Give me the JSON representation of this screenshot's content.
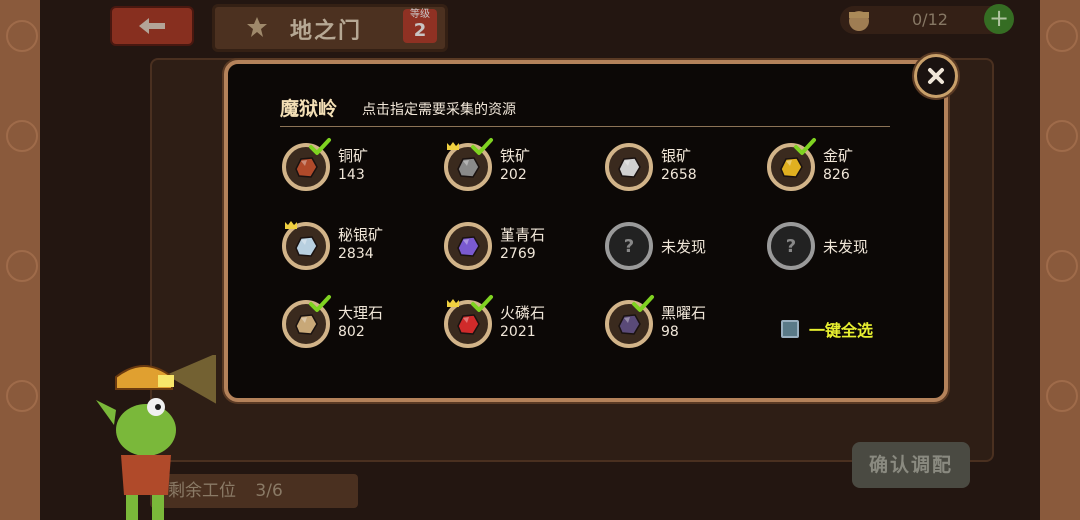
{
  "header": {
    "gate_title": "地之门",
    "level_label": "等级",
    "level_value": "2",
    "worker_count": "0/12"
  },
  "background": {
    "remaining_slots_label": "剩余工位",
    "remaining_slots_value": "3/6",
    "confirm_label": "确认调配"
  },
  "modal": {
    "title": "魔狱岭",
    "subtitle": "点击指定需要采集的资源",
    "select_all_label": "一键全选",
    "resources": [
      {
        "name": "铜矿",
        "count": "143",
        "checked": true,
        "crown": false,
        "color": "#b04a2a"
      },
      {
        "name": "铁矿",
        "count": "202",
        "checked": true,
        "crown": true,
        "color": "#8a8a8a"
      },
      {
        "name": "银矿",
        "count": "2658",
        "checked": false,
        "crown": false,
        "color": "#d0d0d0"
      },
      {
        "name": "金矿",
        "count": "826",
        "checked": true,
        "crown": false,
        "color": "#e0b020"
      },
      {
        "name": "秘银矿",
        "count": "2834",
        "checked": false,
        "crown": true,
        "color": "#b8d0e0"
      },
      {
        "name": "堇青石",
        "count": "2769",
        "checked": false,
        "crown": false,
        "color": "#7a5ad0"
      },
      {
        "name": "未发现",
        "count": "",
        "checked": false,
        "crown": false,
        "color": "#888888"
      },
      {
        "name": "未发现",
        "count": "",
        "checked": false,
        "crown": false,
        "color": "#888888"
      },
      {
        "name": "大理石",
        "count": "802",
        "checked": true,
        "crown": false,
        "color": "#c8a878"
      },
      {
        "name": "火磷石",
        "count": "2021",
        "checked": true,
        "crown": true,
        "color": "#d02a2a"
      },
      {
        "name": "黑曜石",
        "count": "98",
        "checked": true,
        "crown": false,
        "color": "#5a4a78"
      }
    ]
  },
  "colors": {
    "modal_border": "#b4825a",
    "check_green": "#7fd321",
    "select_all_text": "#e8f030"
  }
}
